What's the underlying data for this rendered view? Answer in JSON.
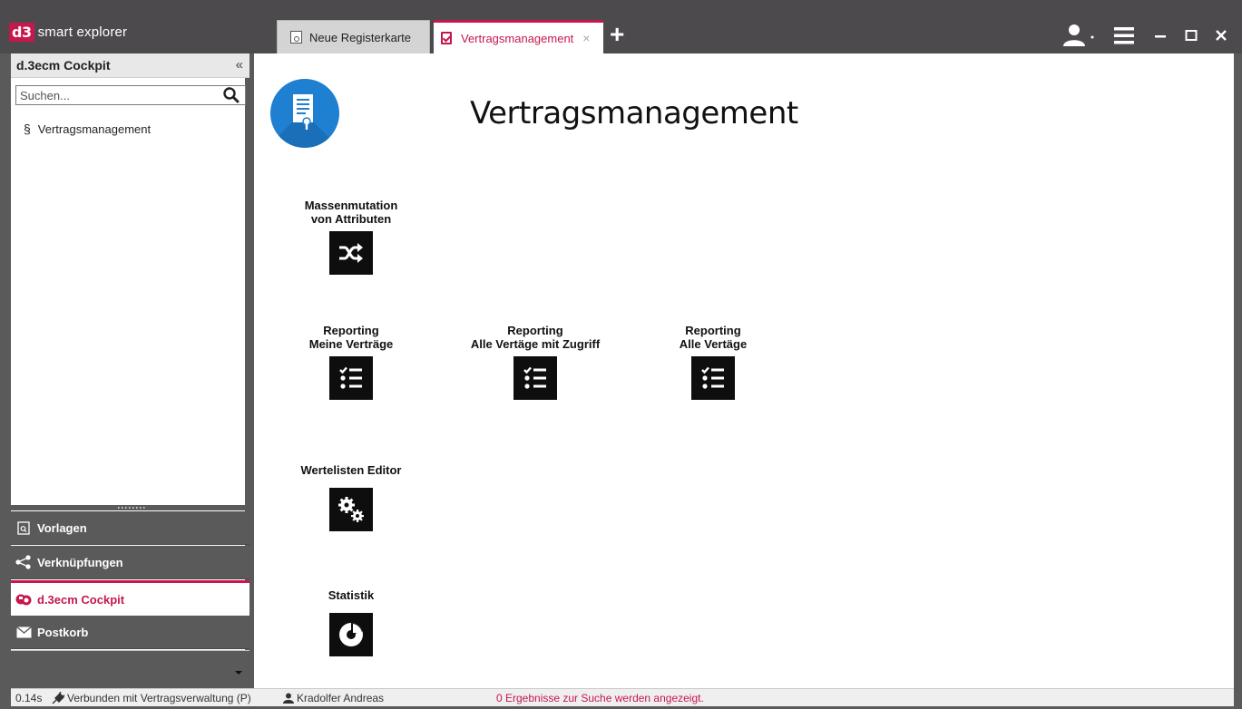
{
  "app": {
    "logo_badge": "d3",
    "logo_text": "smart explorer"
  },
  "tabs": [
    {
      "label": "Neue Registerkarte",
      "icon": "search-document-icon",
      "active": false
    },
    {
      "label": "Vertragsmanagement",
      "icon": "checkbox-document-icon",
      "active": true,
      "close": "×"
    }
  ],
  "tab_add": "+",
  "window_controls": {
    "minimize": "–",
    "maximize": "□",
    "close": "✕"
  },
  "sidebar": {
    "title": "d.3ecm Cockpit",
    "collapse": "«",
    "search_placeholder": "Suchen...",
    "tree": [
      {
        "symbol": "§",
        "label": "Vertragsmanagement"
      }
    ],
    "nav": [
      {
        "label": "Vorlagen",
        "icon": "template-icon",
        "active": false
      },
      {
        "label": "Verknüpfungen",
        "icon": "share-icon",
        "active": false
      },
      {
        "label": "d.3ecm Cockpit",
        "icon": "cockpit-icon",
        "active": true
      },
      {
        "label": "Postkorb",
        "icon": "mail-icon",
        "active": false
      }
    ]
  },
  "main": {
    "title": "Vertragsmanagement",
    "tiles": {
      "massenmutation": {
        "line1": "Massenmutation",
        "line2": "von Attributen",
        "icon": "shuffle-icon"
      },
      "reporting_meine": {
        "line1": "Reporting",
        "line2": "Meine Verträge",
        "icon": "checklist-icon"
      },
      "reporting_zugriff": {
        "line1": "Reporting",
        "line2": "Alle Vertäge mit Zugriff",
        "icon": "checklist-icon"
      },
      "reporting_alle": {
        "line1": "Reporting",
        "line2": "Alle Vertäge",
        "icon": "checklist-icon"
      },
      "wertelisten": {
        "line1": "",
        "line2": "Wertelisten Editor",
        "icon": "gears-icon"
      },
      "statistik": {
        "line1": "",
        "line2": "Statistik",
        "icon": "pie-chart-icon"
      }
    }
  },
  "status": {
    "time": "0.14s",
    "connection": "Verbunden mit Vertragsverwaltung (P)",
    "user": "Kradolfer Andreas",
    "message": "0 Ergebnisse zur Suche werden angezeigt."
  },
  "colors": {
    "accent": "#c7174c",
    "titlebar": "#4d4a4e",
    "frame": "#5a5a5a",
    "logo_blue": "#1f7fd0"
  }
}
